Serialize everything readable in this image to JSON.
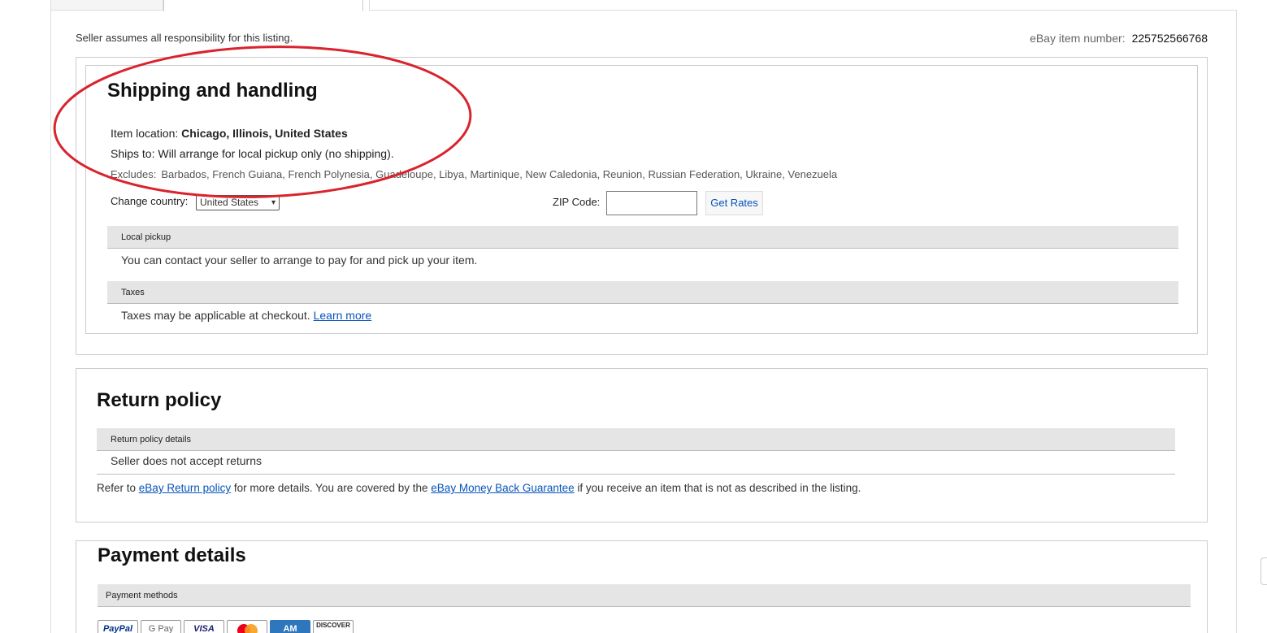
{
  "header": {
    "seller_note": "Seller assumes all responsibility for this listing.",
    "item_number_label": "eBay item number:",
    "item_number": "225752566768"
  },
  "shipping": {
    "title": "Shipping and handling",
    "location_label": "Item location:",
    "location_value": "Chicago, Illinois, United States",
    "ships_to_label": "Ships to:",
    "ships_to_value": "Will arrange for local pickup only (no shipping).",
    "excludes_label": "Excludes:",
    "excludes_value": "Barbados, French Guiana, French Polynesia, Guadeloupe, Libya, Martinique, New Caledonia, Reunion, Russian Federation, Ukraine, Venezuela",
    "change_country_label": "Change country:",
    "country_selected": "United States",
    "zip_label": "ZIP Code:",
    "zip_value": "",
    "get_rates_label": "Get Rates",
    "local_pickup_header": "Local pickup",
    "local_pickup_text": "You can contact your seller to arrange to pay for and pick up your item.",
    "taxes_header": "Taxes",
    "taxes_text": "Taxes may be applicable at checkout.",
    "taxes_link": "Learn more"
  },
  "returns": {
    "title": "Return policy",
    "details_header": "Return policy details",
    "details_text": "Seller does not accept returns",
    "refer_prefix": "Refer to",
    "refer_link1": "eBay Return policy",
    "refer_mid": "for more details. You are covered by the",
    "refer_link2": "eBay Money Back Guarantee",
    "refer_suffix": "if you receive an item that is not as described in the listing."
  },
  "payment": {
    "title": "Payment details",
    "methods_header": "Payment methods",
    "methods": [
      "PayPal",
      "G Pay",
      "VISA",
      "Mastercard",
      "AM",
      "DISCOVER"
    ]
  },
  "colors": {
    "link": "#0654ba",
    "annotation": "#d9232d",
    "bar_bg": "#e5e5e5"
  }
}
